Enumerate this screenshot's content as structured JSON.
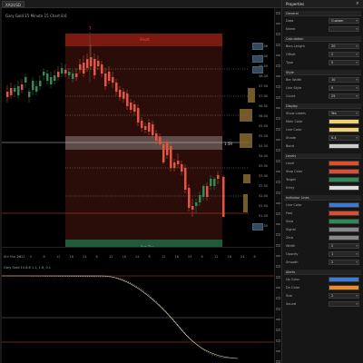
{
  "window": {
    "tabs": [
      {
        "label": "XAUUSD"
      }
    ]
  },
  "chart": {
    "legend": "Gary Gold 15 Minute 15 Chart 8.6",
    "top_marker": "T",
    "zone_label": "Short",
    "bottom_label": "Rgt Top",
    "mid_label": "1.5R",
    "price_labels": [
      "60.06",
      "59.00",
      "58.50",
      "58.00",
      "57.50",
      "57.00",
      "56.50",
      "56.00",
      "55.50",
      "55.00",
      "54.50",
      "54.00",
      "53.50",
      "53.00",
      "52.50",
      "52.00",
      "51.50",
      "51.00",
      "50.50"
    ],
    "time_labels": [
      "6th Mar 2022",
      "24",
      "0",
      "6",
      "12",
      "18",
      "24",
      "6",
      "12",
      "18",
      "24",
      "6",
      "12",
      "18",
      "24",
      "6",
      "12",
      "18",
      "24",
      "6"
    ],
    "indicator_legend": "Gary Gold 15 8.6 1.1, 1.6, 0.1",
    "colors": {
      "up": "#2e8b57",
      "down": "#e8553a",
      "zone_top": "#7a1a10",
      "zone_body": "#2a0d08",
      "zone_bottom": "#1f5a3a",
      "band": "#8a8080",
      "line": "#c8503a",
      "dashed": "#9a8a8a"
    }
  },
  "panel": {
    "title": "Properties",
    "sections": [
      {
        "title": "General",
        "rows": [
          {
            "label": "Data",
            "value": "Custom"
          },
          {
            "label": "Name",
            "value": ""
          }
        ]
      },
      {
        "title": "Calculation",
        "rows": [
          {
            "label": "Bars Length",
            "value": "20"
          },
          {
            "label": "Offset",
            "value": "2"
          },
          {
            "label": "Type",
            "value": "5"
          }
        ]
      },
      {
        "title": "Style",
        "rows": [
          {
            "label": "Bar Width",
            "value": "10"
          },
          {
            "label": "Line Style",
            "value": "0"
          },
          {
            "label": "Count",
            "value": "25"
          }
        ]
      },
      {
        "title": "Display",
        "rows": [
          {
            "label": "Show Labels",
            "value": "Yes"
          },
          {
            "label": "Main Color",
            "swatch": "#f2d06a"
          },
          {
            "label": "Line Color",
            "swatch": "#f2d06a"
          },
          {
            "label": "Shade",
            "value": "0.4"
          },
          {
            "label": "Band",
            "swatch": "#cccccc"
          }
        ]
      },
      {
        "title": "Levels",
        "rows": [
          {
            "label": "Level",
            "swatch": "#e34b2b"
          },
          {
            "label": "Stop Color",
            "swatch": "#e34b2b"
          },
          {
            "label": "Target",
            "swatch": "#2e8b57"
          },
          {
            "label": "Entry",
            "swatch": "#dddddd"
          }
        ]
      },
      {
        "title": "Indicator Lines",
        "rows": [
          {
            "label": "Line Color",
            "swatch": "#3a7bd5"
          },
          {
            "label": "Fast",
            "swatch": "#e34b2b"
          },
          {
            "label": "Slow",
            "swatch": "#2e8b57"
          },
          {
            "label": "Signal",
            "swatch": "#888888"
          },
          {
            "label": "Zero",
            "swatch": "#888888"
          },
          {
            "label": "Width",
            "value": "2"
          },
          {
            "label": "Opacity",
            "value": "1"
          },
          {
            "label": "Smooth",
            "value": "2"
          }
        ]
      },
      {
        "title": "Alerts",
        "rows": [
          {
            "label": "Up Color",
            "swatch": "#3a7bd5"
          },
          {
            "label": "Dn Color",
            "swatch": "#f28c1e"
          },
          {
            "label": "Size",
            "value": "2"
          },
          {
            "label": "Sound",
            "value": ""
          }
        ]
      }
    ]
  }
}
